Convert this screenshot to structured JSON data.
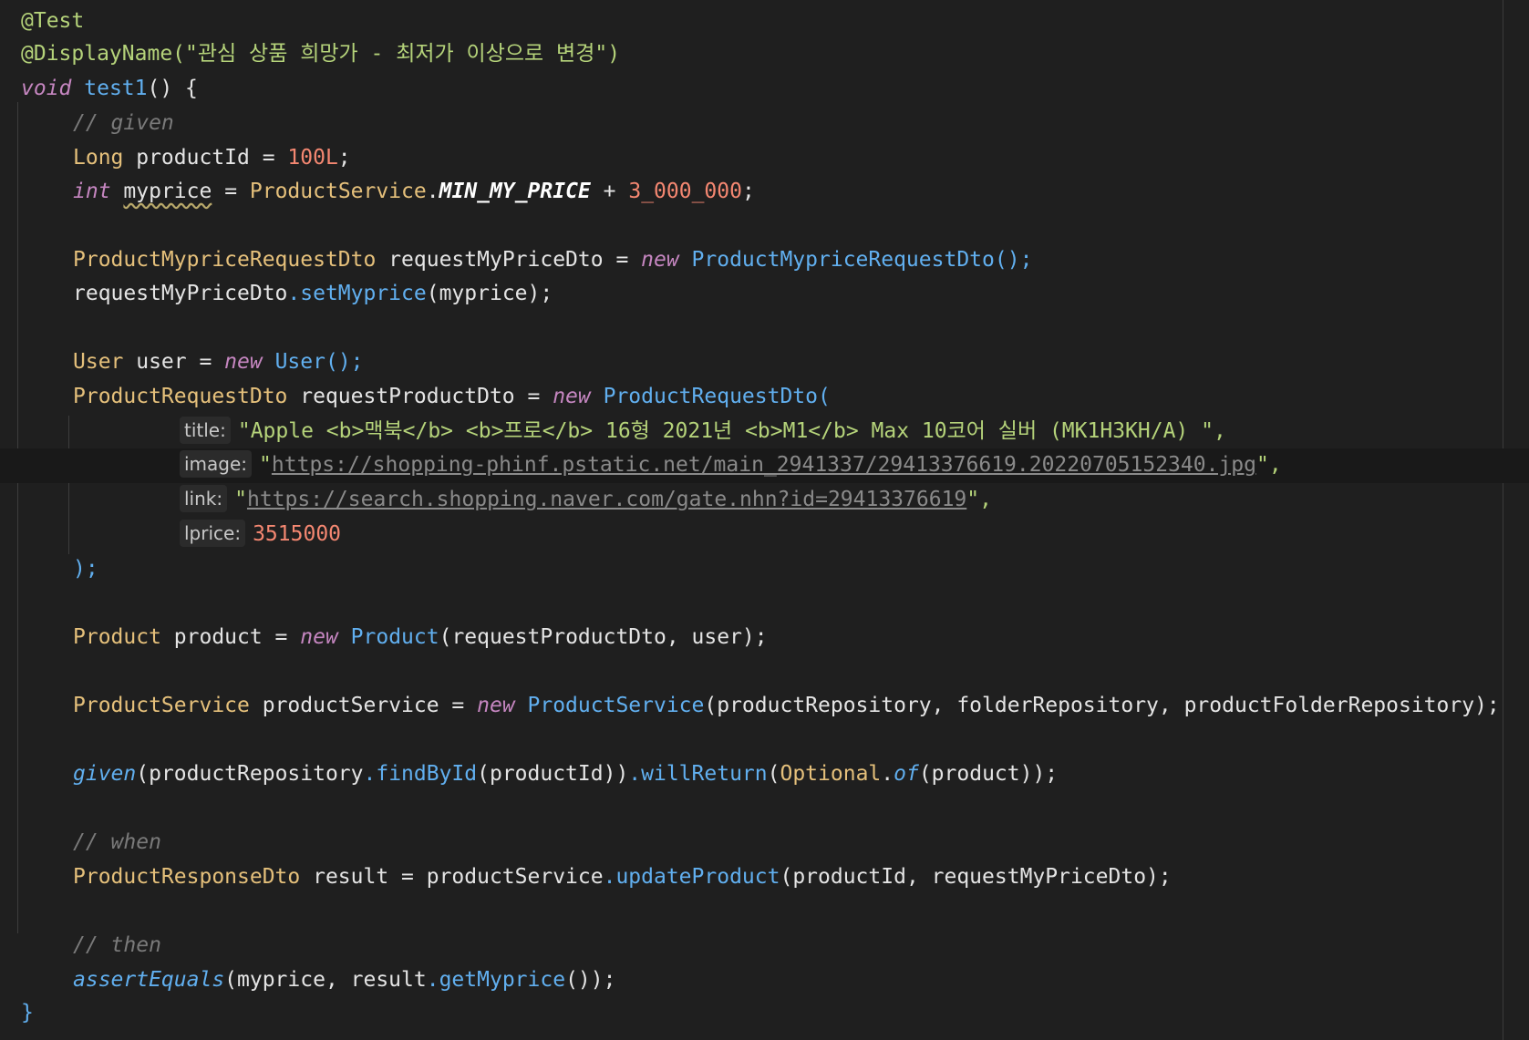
{
  "editor": {
    "annotation_test": "@Test",
    "annotation_display": "@DisplayName",
    "display_name_string": "(\"관심 상품 희망가 - 최저가 이상으로 변경\")",
    "method_kw": "void",
    "method_name": "test1",
    "method_open": "() {",
    "comment_given": "// given",
    "line_productid_type": "Long",
    "line_productid_var": " productId = ",
    "line_productid_val": "100L",
    "line_productid_end": ";",
    "line_myprice_type": "int",
    "line_myprice_var": "myprice",
    "line_myprice_eq": " = ",
    "line_myprice_class": "ProductService",
    "line_myprice_dot": ".",
    "line_myprice_const": "MIN_MY_PRICE",
    "line_myprice_plus": " + ",
    "line_myprice_num": "3_000_000",
    "line_myprice_end": ";",
    "dto_type": "ProductMypriceRequestDto",
    "dto_var": " requestMyPriceDto = ",
    "dto_new": "new",
    "dto_ctor": " ProductMypriceRequestDto",
    "dto_end": "();",
    "setmyprice_obj": "requestMyPriceDto",
    "setmyprice_method": ".setMyprice",
    "setmyprice_args": "(myprice);",
    "user_type": "User",
    "user_var": " user = ",
    "user_new": "new",
    "user_ctor": " User",
    "user_end": "();",
    "prd_req_type": "ProductRequestDto",
    "prd_req_var": " requestProductDto = ",
    "prd_req_new": "new",
    "prd_req_ctor": " ProductRequestDto(",
    "hint_title": "title:",
    "title_value": "\"Apple <b>맥북</b> <b>프로</b> 16형 2021년 <b>M1</b> Max 10코어 실버 (MK1H3KH/A) \",",
    "hint_image": "image:",
    "image_quote_open": "\"",
    "image_url": "https://shopping-phinf.pstatic.net/main_2941337/29413376619.20220705152340.jpg",
    "image_quote_close": "\",",
    "hint_link": "link:",
    "link_quote_open": "\"",
    "link_url": "https://search.shopping.naver.com/gate.nhn?id=29413376619",
    "link_quote_close": "\",",
    "hint_lprice": "lprice:",
    "lprice_value": "3515000",
    "prd_req_close": ");",
    "product_type": "Product",
    "product_var": " product = ",
    "product_new": "new",
    "product_ctor": " Product",
    "product_args": "(requestProductDto, user);",
    "service_type": "ProductService",
    "service_var": " productService = ",
    "service_new": "new",
    "service_ctor": " ProductService",
    "service_args": "(productRepository, folderRepository, productFolderRepository);",
    "given_fn": "given",
    "given_open": "(productRepository",
    "given_find": ".findById",
    "given_mid": "(productId))",
    "given_will": ".willReturn",
    "given_paren": "(",
    "given_optional": "Optional",
    "given_dot": ".",
    "given_of": "of",
    "given_end": "(product));",
    "comment_when": "// when",
    "resp_type": "ProductResponseDto",
    "resp_var": " result = productService",
    "resp_method": ".updateProduct",
    "resp_args": "(productId, requestMyPriceDto);",
    "comment_then": "// then",
    "assert_fn": "assertEquals",
    "assert_args": "(myprice, result",
    "assert_get": ".getMyprice",
    "assert_end": "());",
    "close_brace": "}"
  },
  "colors": {
    "background": "#1f1f1f",
    "keyword": "#c586c0",
    "type": "#e5c07b",
    "function": "#61afef",
    "string": "#b5d37a",
    "number": "#f48771",
    "comment": "#7a7a7a"
  }
}
